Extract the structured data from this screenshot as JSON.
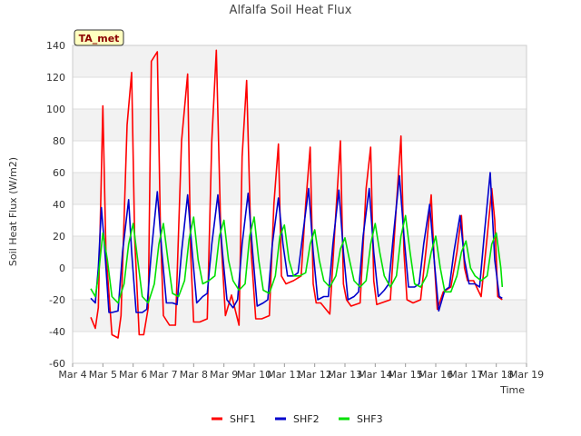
{
  "chart_data": {
    "type": "line",
    "title": "Alfalfa Soil Heat Flux",
    "xlabel": "Time",
    "ylabel": "Soil Heat Flux (W/m2)",
    "ylim": [
      -60,
      140
    ],
    "xlim": [
      0,
      15
    ],
    "yticks": [
      -60,
      -40,
      -20,
      0,
      20,
      40,
      60,
      80,
      100,
      120,
      140
    ],
    "xticks": [
      0,
      1,
      2,
      3,
      4,
      5,
      6,
      7,
      8,
      9,
      10,
      11,
      12,
      13,
      14,
      15
    ],
    "xtick_labels": [
      "Mar 4",
      "Mar 5",
      "Mar 6",
      "Mar 7",
      "Mar 8",
      "Mar 9",
      "Mar 10",
      "Mar 11",
      "Mar 12",
      "Mar 13",
      "Mar 14",
      "Mar 15",
      "Mar 16",
      "Mar 17",
      "Mar 18",
      "Mar 19"
    ],
    "grid": "horizontal bands",
    "legend_position": "bottom",
    "annotation": "TA_met",
    "series": [
      {
        "name": "SHF1",
        "color": "#ff0000",
        "x": [
          0.6,
          0.75,
          0.85,
          0.95,
          1.0,
          1.1,
          1.3,
          1.5,
          1.6,
          1.8,
          1.95,
          2.05,
          2.2,
          2.35,
          2.5,
          2.6,
          2.8,
          2.9,
          3.0,
          3.2,
          3.4,
          3.6,
          3.8,
          3.9,
          4.0,
          4.2,
          4.45,
          4.6,
          4.75,
          4.9,
          5.05,
          5.25,
          5.5,
          5.6,
          5.75,
          5.9,
          6.05,
          6.25,
          6.5,
          6.65,
          6.8,
          6.9,
          7.05,
          7.3,
          7.55,
          7.7,
          7.85,
          7.95,
          8.05,
          8.2,
          8.5,
          8.7,
          8.85,
          8.95,
          9.05,
          9.2,
          9.5,
          9.7,
          9.85,
          9.95,
          10.05,
          10.2,
          10.5,
          10.7,
          10.85,
          10.95,
          11.05,
          11.25,
          11.5,
          11.7,
          11.85,
          11.95,
          12.05,
          12.25,
          12.5,
          12.7,
          12.85,
          12.95,
          13.05,
          13.25,
          13.5,
          13.7,
          13.85,
          13.95,
          14.05,
          14.2
        ],
        "values": [
          -31,
          -38,
          -25,
          60,
          102,
          10,
          -42,
          -44,
          -30,
          90,
          123,
          20,
          -42,
          -42,
          -25,
          130,
          136,
          25,
          -30,
          -36,
          -36,
          80,
          122,
          10,
          -34,
          -34,
          -32,
          80,
          137,
          20,
          -30,
          -17,
          -36,
          70,
          118,
          10,
          -32,
          -32,
          -30,
          40,
          78,
          -5,
          -10,
          -8,
          -5,
          40,
          76,
          -10,
          -22,
          -22,
          -29,
          35,
          80,
          -10,
          -20,
          -24,
          -22,
          50,
          76,
          -8,
          -23,
          -22,
          -20,
          40,
          83,
          10,
          -20,
          -22,
          -20,
          15,
          46,
          5,
          -26,
          -15,
          -12,
          10,
          33,
          0,
          -8,
          -8,
          -18,
          20,
          50,
          30,
          -18,
          -20
        ]
      },
      {
        "name": "SHF2",
        "color": "#0000cc",
        "x": [
          0.6,
          0.75,
          0.85,
          0.95,
          1.05,
          1.2,
          1.3,
          1.5,
          1.65,
          1.85,
          1.95,
          2.1,
          2.3,
          2.45,
          2.6,
          2.8,
          2.95,
          3.1,
          3.3,
          3.45,
          3.6,
          3.8,
          3.95,
          4.1,
          4.3,
          4.45,
          4.6,
          4.8,
          4.95,
          5.1,
          5.3,
          5.45,
          5.6,
          5.8,
          5.95,
          6.1,
          6.3,
          6.45,
          6.6,
          6.8,
          6.95,
          7.1,
          7.3,
          7.45,
          7.6,
          7.8,
          7.95,
          8.1,
          8.3,
          8.45,
          8.6,
          8.8,
          8.95,
          9.1,
          9.3,
          9.45,
          9.6,
          9.8,
          9.95,
          10.1,
          10.3,
          10.45,
          10.6,
          10.8,
          10.95,
          11.1,
          11.3,
          11.45,
          11.6,
          11.8,
          11.95,
          12.1,
          12.3,
          12.45,
          12.6,
          12.8,
          12.95,
          13.1,
          13.3,
          13.45,
          13.6,
          13.8,
          13.95,
          14.1,
          14.2
        ],
        "values": [
          -19,
          -22,
          0,
          38,
          15,
          -28,
          -28,
          -27,
          10,
          43,
          10,
          -28,
          -28,
          -26,
          10,
          48,
          10,
          -22,
          -22,
          -23,
          10,
          46,
          10,
          -22,
          -18,
          -16,
          15,
          46,
          10,
          -20,
          -25,
          -20,
          15,
          47,
          10,
          -24,
          -22,
          -20,
          15,
          44,
          15,
          -5,
          -5,
          -3,
          20,
          50,
          10,
          -20,
          -18,
          -18,
          15,
          49,
          10,
          -20,
          -18,
          -15,
          20,
          50,
          10,
          -18,
          -14,
          -10,
          20,
          58,
          20,
          -12,
          -12,
          -10,
          15,
          40,
          5,
          -27,
          -14,
          -12,
          10,
          33,
          5,
          -10,
          -10,
          -12,
          20,
          60,
          5,
          -18,
          -19
        ]
      },
      {
        "name": "SHF3",
        "color": "#00e000",
        "x": [
          0.6,
          0.75,
          0.85,
          1.0,
          1.15,
          1.3,
          1.5,
          1.7,
          1.85,
          2.0,
          2.15,
          2.3,
          2.5,
          2.7,
          2.85,
          3.0,
          3.15,
          3.3,
          3.5,
          3.7,
          3.85,
          4.0,
          4.15,
          4.3,
          4.5,
          4.7,
          4.85,
          5.0,
          5.15,
          5.3,
          5.5,
          5.7,
          5.85,
          6.0,
          6.15,
          6.3,
          6.5,
          6.7,
          6.85,
          7.0,
          7.15,
          7.3,
          7.5,
          7.7,
          7.85,
          8.0,
          8.15,
          8.3,
          8.5,
          8.7,
          8.85,
          9.0,
          9.15,
          9.3,
          9.5,
          9.7,
          9.85,
          10.0,
          10.15,
          10.3,
          10.5,
          10.7,
          10.85,
          11.0,
          11.15,
          11.3,
          11.5,
          11.7,
          11.85,
          12.0,
          12.15,
          12.3,
          12.5,
          12.7,
          12.85,
          13.0,
          13.15,
          13.3,
          13.5,
          13.7,
          13.85,
          14.0,
          14.15,
          14.2
        ],
        "values": [
          -13,
          -18,
          -5,
          22,
          5,
          -18,
          -22,
          -10,
          15,
          28,
          5,
          -18,
          -22,
          -10,
          15,
          28,
          5,
          -16,
          -18,
          -8,
          18,
          32,
          5,
          -10,
          -8,
          -5,
          20,
          30,
          5,
          -8,
          -14,
          -10,
          20,
          32,
          5,
          -14,
          -16,
          -5,
          20,
          27,
          5,
          -5,
          -5,
          -3,
          15,
          24,
          5,
          -8,
          -12,
          -5,
          12,
          19,
          5,
          -8,
          -12,
          -8,
          15,
          28,
          10,
          -5,
          -12,
          -5,
          20,
          33,
          10,
          -10,
          -12,
          -5,
          10,
          20,
          0,
          -15,
          -15,
          -5,
          10,
          17,
          0,
          -5,
          -8,
          -5,
          15,
          22,
          0,
          -12
        ]
      }
    ]
  }
}
